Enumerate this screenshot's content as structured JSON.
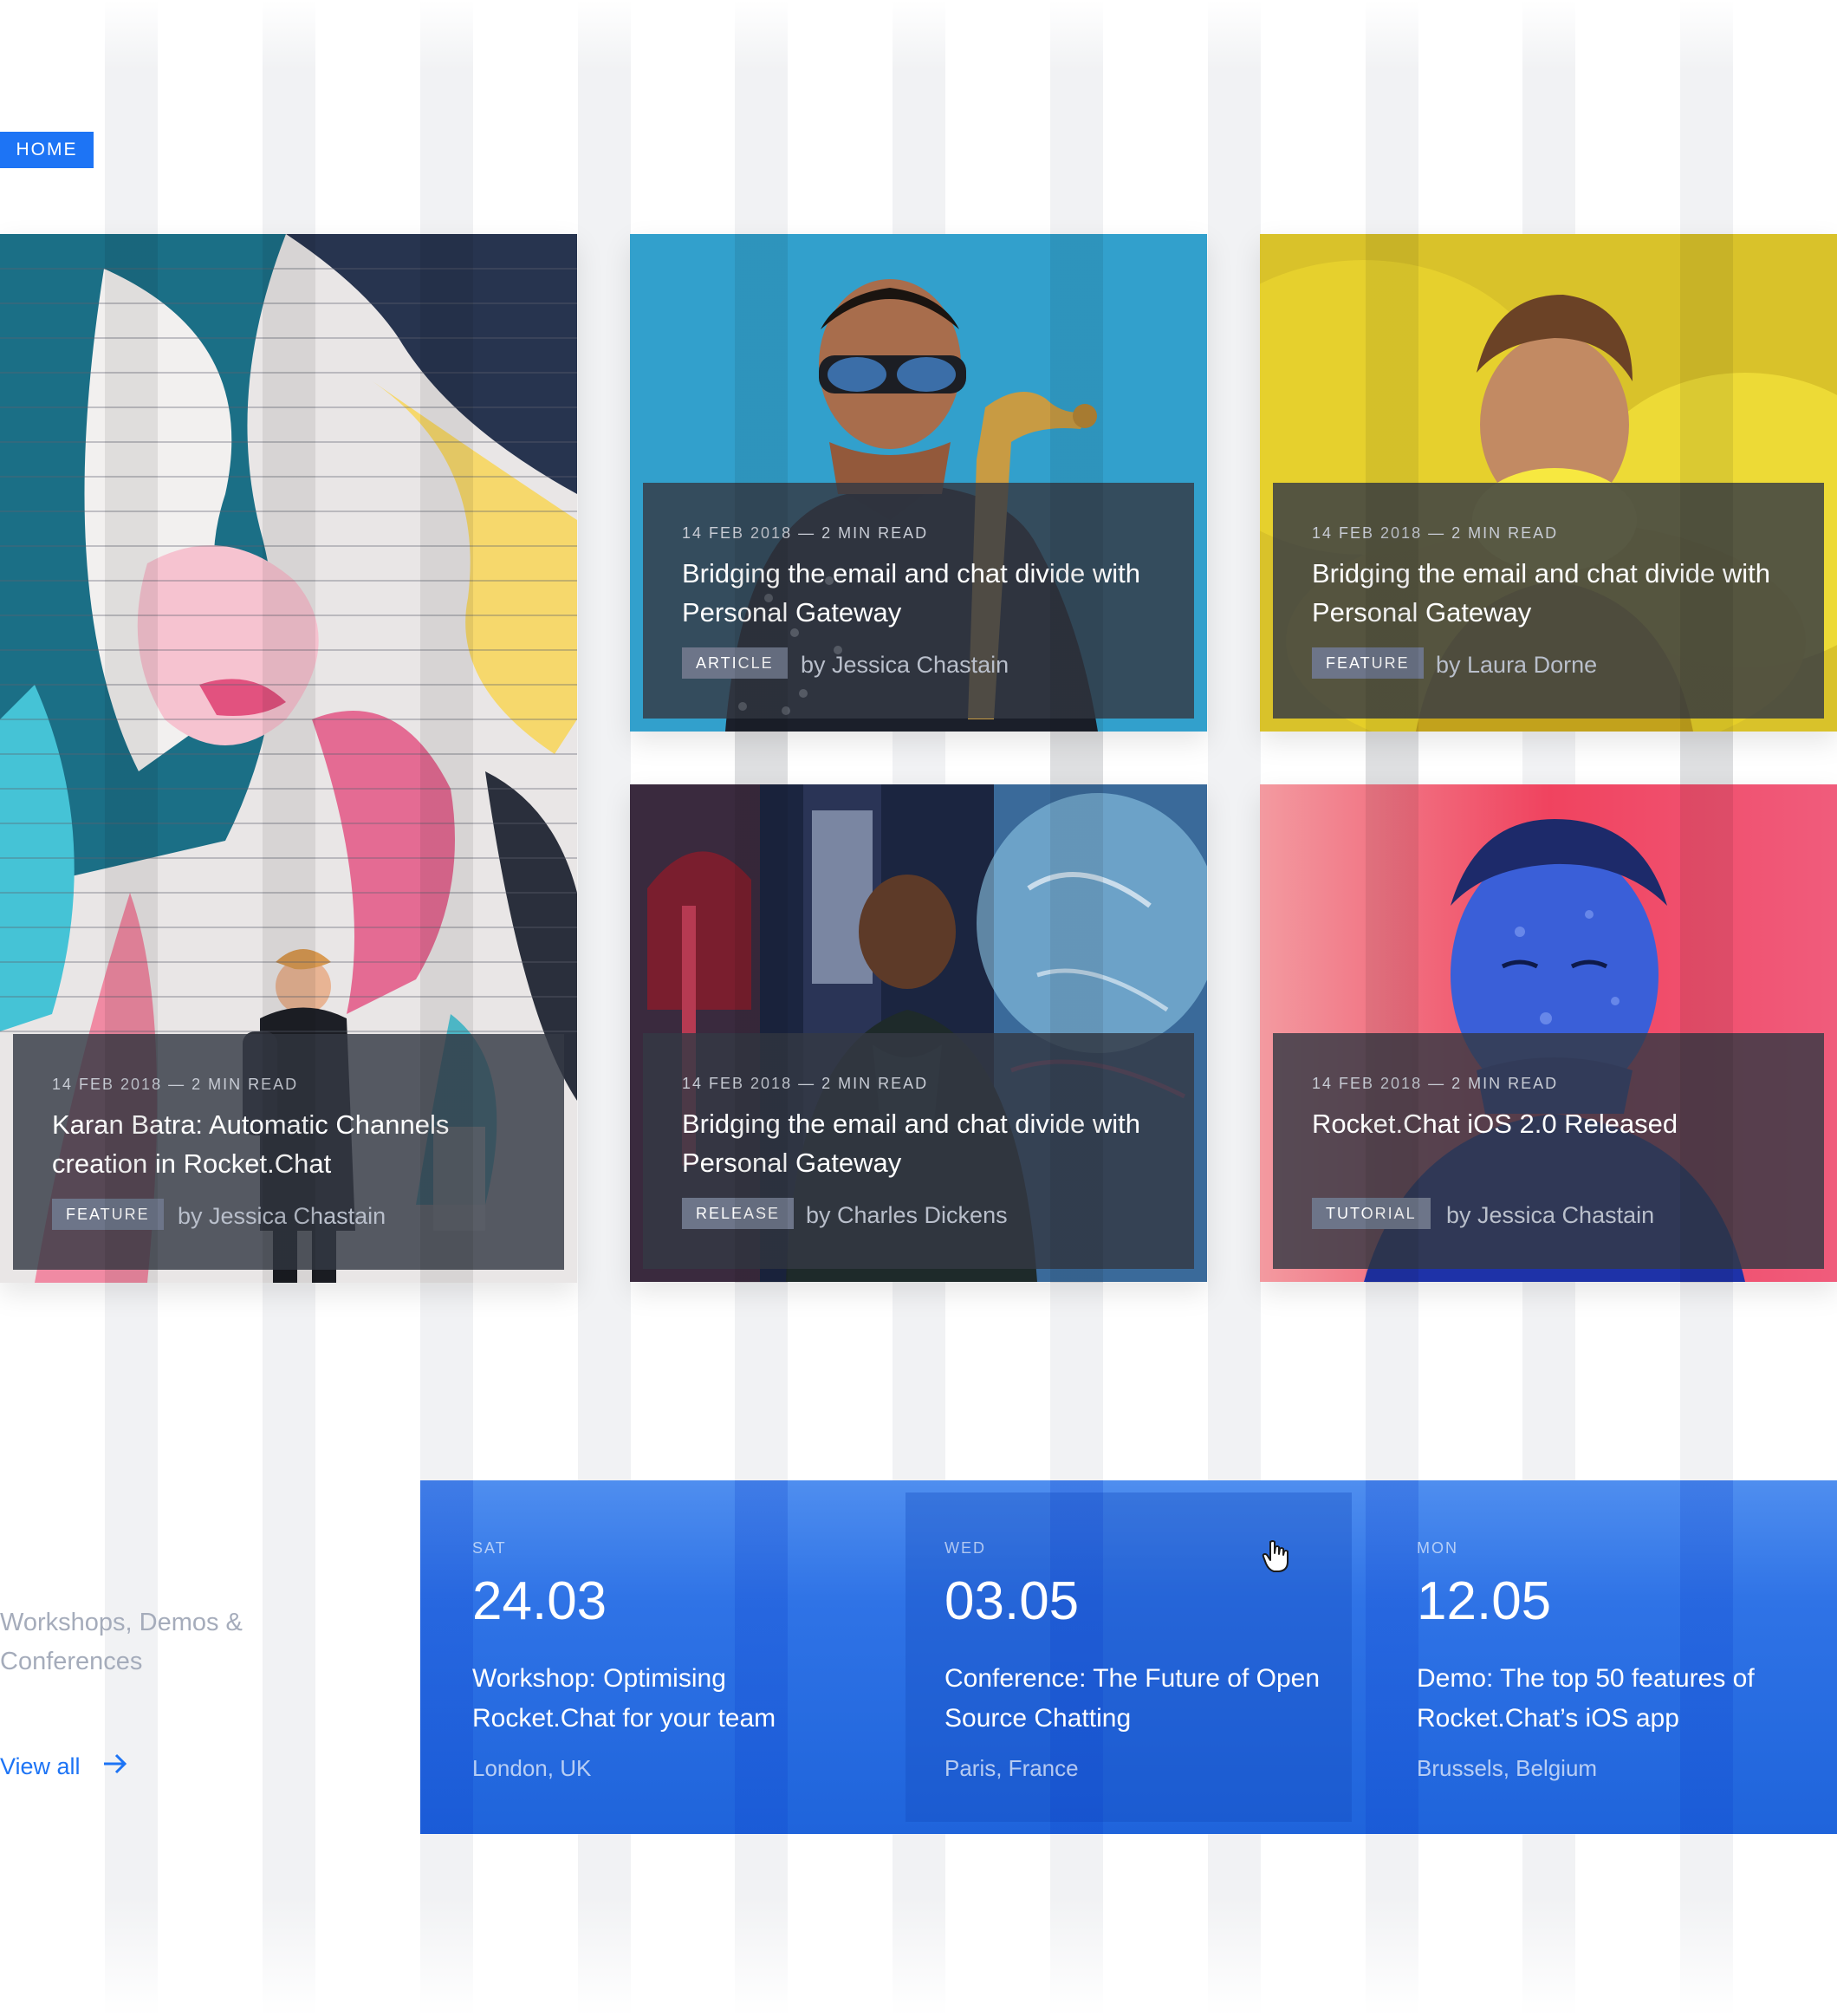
{
  "breadcrumb": {
    "label": "HOME"
  },
  "posts": [
    {
      "meta": "14 FEB 2018 — 2 MIN READ",
      "title": "Karan Batra: Automatic Channels creation in Rocket.Chat",
      "tag": "FEATURE",
      "author": "by Jessica Chastain",
      "image": "mural-photo"
    },
    {
      "meta": "14 FEB 2018 — 2 MIN READ",
      "title": "Bridging the email and chat divide with Personal Gateway",
      "tag": "ARTICLE",
      "author": "by Jessica Chastain",
      "image": "saxophone-photo"
    },
    {
      "meta": "14 FEB 2018 — 2 MIN READ",
      "title": "Bridging the email and chat divide with Personal Gateway",
      "tag": "FEATURE",
      "author": "by Laura Dorne",
      "image": "yellow-smoke-photo"
    },
    {
      "meta": "14 FEB 2018 — 2 MIN READ",
      "title": "Bridging the email and chat divide with Personal Gateway",
      "tag": "RELEASE",
      "author": "by Charles Dickens",
      "image": "neon-street-photo"
    },
    {
      "meta": "14 FEB 2018 — 2 MIN READ",
      "title": "Rocket.Chat iOS 2.0 Released",
      "tag": "TUTORIAL",
      "author": "by Jessica Chastain",
      "image": "blue-paint-face-photo"
    }
  ],
  "events_section": {
    "title": "Workshops, Demos & Conferences",
    "view_all": "View all",
    "items": [
      {
        "day": "SAT",
        "date": "24.03",
        "title": "Workshop: Optimising Rocket.Chat for your team",
        "location": "London, UK"
      },
      {
        "day": "WED",
        "date": "03.05",
        "title": "Conference: The Future of Open Source Chatting",
        "location": "Paris, France"
      },
      {
        "day": "MON",
        "date": "12.05",
        "title": "Demo: The top 50 features of Rocket.Chat’s iOS app",
        "location": "Brussels, Belgium"
      }
    ]
  },
  "colors": {
    "accent": "#1d74f5",
    "panel": "#353944",
    "tag": "#6d7589",
    "muted_text": "#a5acbb"
  },
  "icons": {
    "view_all": "arrow-right-icon",
    "cursor": "hand-pointer-icon"
  }
}
